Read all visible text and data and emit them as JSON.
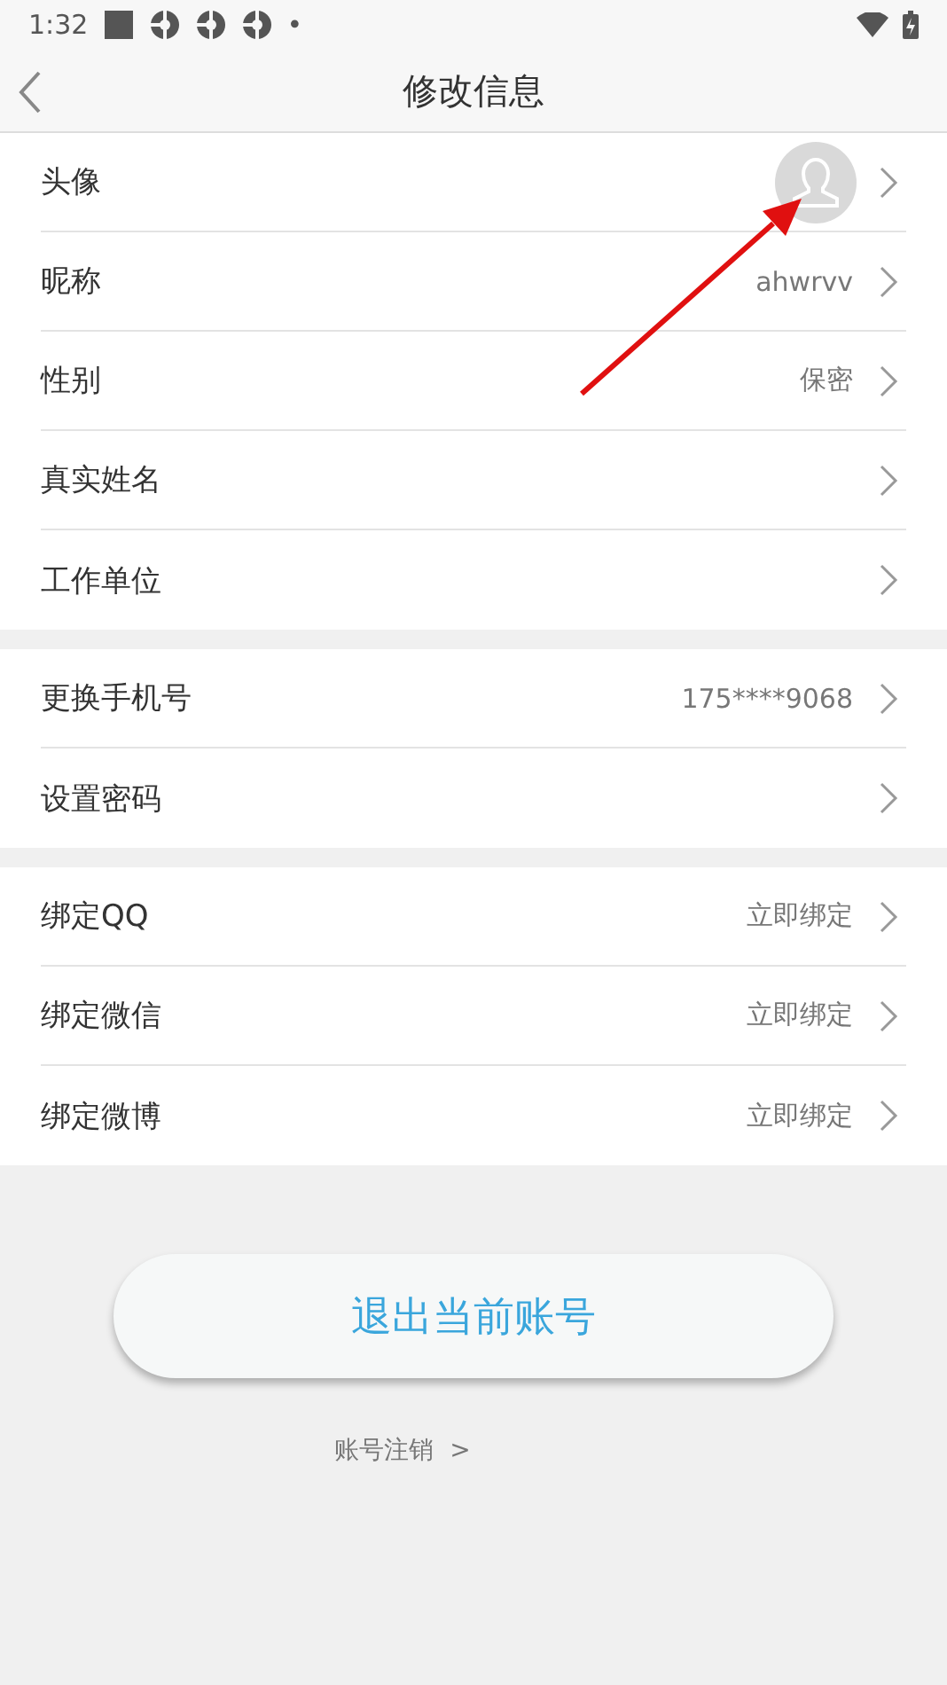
{
  "status_bar": {
    "time": "1:32",
    "more": "•"
  },
  "header": {
    "title": "修改信息"
  },
  "groups": [
    {
      "rows": [
        {
          "kind": "avatar",
          "label": "头像"
        },
        {
          "kind": "text",
          "label": "昵称",
          "value": "ahwrvv"
        },
        {
          "kind": "text",
          "label": "性别",
          "value": "保密"
        },
        {
          "kind": "text",
          "label": "真实姓名"
        },
        {
          "kind": "text",
          "label": "工作单位"
        }
      ]
    },
    {
      "rows": [
        {
          "kind": "text",
          "label": "更换手机号",
          "value": "175****9068"
        },
        {
          "kind": "text",
          "label": "设置密码"
        }
      ]
    },
    {
      "rows": [
        {
          "kind": "text",
          "label": "绑定QQ",
          "value": "立即绑定"
        },
        {
          "kind": "text",
          "label": "绑定微信",
          "value": "立即绑定"
        },
        {
          "kind": "text",
          "label": "绑定微博",
          "value": "立即绑定"
        }
      ]
    }
  ],
  "logout_button": "退出当前账号",
  "cancel_link": "账号注销  >"
}
